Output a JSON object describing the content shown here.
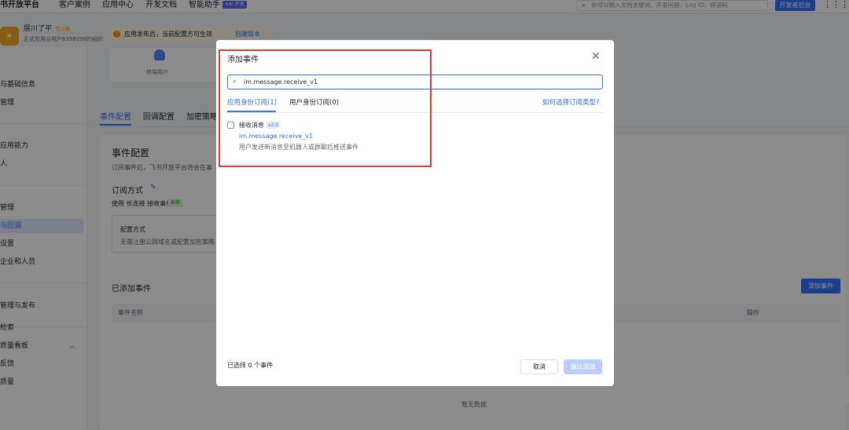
{
  "topnav": {
    "brand": "书开放平台",
    "items": [
      "客户案例",
      "应用中心",
      "开发文档",
      "智能助手"
    ],
    "ai_badge": "✦AI 开发",
    "search_placeholder": "你可以输入文档关键词、开发问题、Log ID、错误码",
    "dev_console": "开发者后台"
  },
  "app": {
    "name": "层川了平",
    "status": "已上线",
    "subtitle": "正式应用@用户6358298的组织"
  },
  "notice": {
    "text": "应用发布后，当前配置方可生效",
    "link": "创建版本"
  },
  "sidebar": {
    "items": [
      {
        "label": "与基础信息"
      },
      {
        "label": "管理"
      },
      {
        "label": "应用能力"
      },
      {
        "label": "人"
      },
      {
        "label": "管理"
      },
      {
        "label": "与回调"
      },
      {
        "label": "设置"
      },
      {
        "label": "企业和人员"
      },
      {
        "label": "管理与发布"
      },
      {
        "label": "检索"
      },
      {
        "label": "质量看板"
      },
      {
        "label": "反馈"
      },
      {
        "label": "质量"
      }
    ]
  },
  "background": {
    "diagram_label": "终端用户",
    "tabs": [
      "事件配置",
      "回调配置",
      "加密策略"
    ],
    "card_title": "事件配置",
    "card_desc": "订阅事件后，飞书开放平台将会在事",
    "sub_title": "订阅方式",
    "use_text": "使用 长连接 接收事件",
    "rec_badge": "推荐",
    "cfg_title": "配置方式",
    "cfg_desc": "无需注册公网域名或配置加密策略",
    "added_title": "已添加事件",
    "add_event_btn": "添加事件",
    "col_name": "事件名称",
    "col_action": "操作",
    "empty": "暂无数据"
  },
  "modal": {
    "title": "添加事件",
    "search_value": "im.message.receive_v1",
    "tabs": [
      "应用身份订阅(1)",
      "用户身份订阅(0)"
    ],
    "help_link": "如何选择订阅类型?",
    "event": {
      "name": "接收消息",
      "version": "v2.0",
      "key": "im.message.receive_v1",
      "desc": "用户发送新消息至机器人或群聊后推送事件"
    },
    "selected_text": "已选择 0 个事件",
    "cancel": "取消",
    "confirm": "确认添加"
  },
  "colors": {
    "accent": "#3370ff",
    "annotation": "#e53935"
  }
}
